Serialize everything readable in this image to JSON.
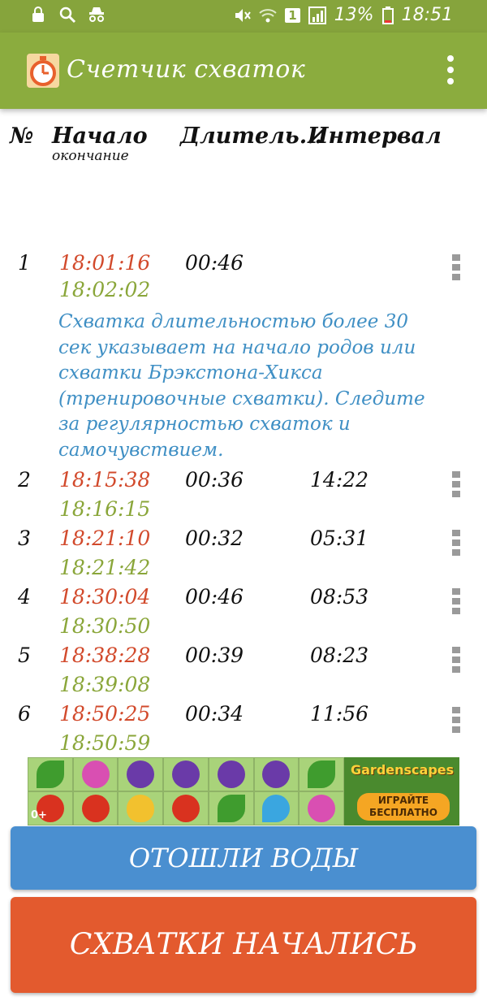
{
  "status_bar": {
    "battery": "13%",
    "time": "18:51",
    "sim_slot": "1",
    "icons_left": [
      "lock-icon",
      "search-icon",
      "incognito-icon"
    ],
    "icons_right": [
      "mute-icon",
      "wifi-icon",
      "signal-icon",
      "battery-icon"
    ]
  },
  "app_bar": {
    "title": "Счетчик схваток",
    "icon": "stopwatch-icon",
    "menu_icon": "more-vert-icon"
  },
  "table": {
    "headers": {
      "number": "№",
      "start": "Начало",
      "start_sub": "окончание",
      "duration": "Длитель...",
      "interval": "Интервал"
    },
    "rows": [
      {
        "no": "1",
        "start": "18:01:16",
        "end": "18:02:02",
        "duration": "00:46",
        "interval": ""
      },
      {
        "no": "2",
        "start": "18:15:38",
        "end": "18:16:15",
        "duration": "00:36",
        "interval": "14:22"
      },
      {
        "no": "3",
        "start": "18:21:10",
        "end": "18:21:42",
        "duration": "00:32",
        "interval": "05:31"
      },
      {
        "no": "4",
        "start": "18:30:04",
        "end": "18:30:50",
        "duration": "00:46",
        "interval": "08:53"
      },
      {
        "no": "5",
        "start": "18:38:28",
        "end": "18:39:08",
        "duration": "00:39",
        "interval": "08:23"
      },
      {
        "no": "6",
        "start": "18:50:25",
        "end": "18:50:59",
        "duration": "00:34",
        "interval": "11:56"
      }
    ],
    "note": "Схватка длительностью более 30 сек указывает на начало родов или схватки Брэкстона-Хикса (тренировочные схватки). Следите за регулярностью схваток и самочувствием."
  },
  "ad": {
    "brand": "Gardenscapes",
    "cta": "ИГРАЙТЕ БЕСПЛАТНО",
    "age": "0+"
  },
  "buttons": {
    "water": "ОТОШЛИ ВОДЫ",
    "start": "СХВАТКИ НАЧАЛИСЬ"
  },
  "colors": {
    "app_bar": "#8bac3e",
    "start_time": "#d24a2c",
    "end_time": "#8aa63a",
    "note": "#3f8fc4",
    "water_button": "#4a8fd0",
    "start_button": "#e35a2e"
  }
}
